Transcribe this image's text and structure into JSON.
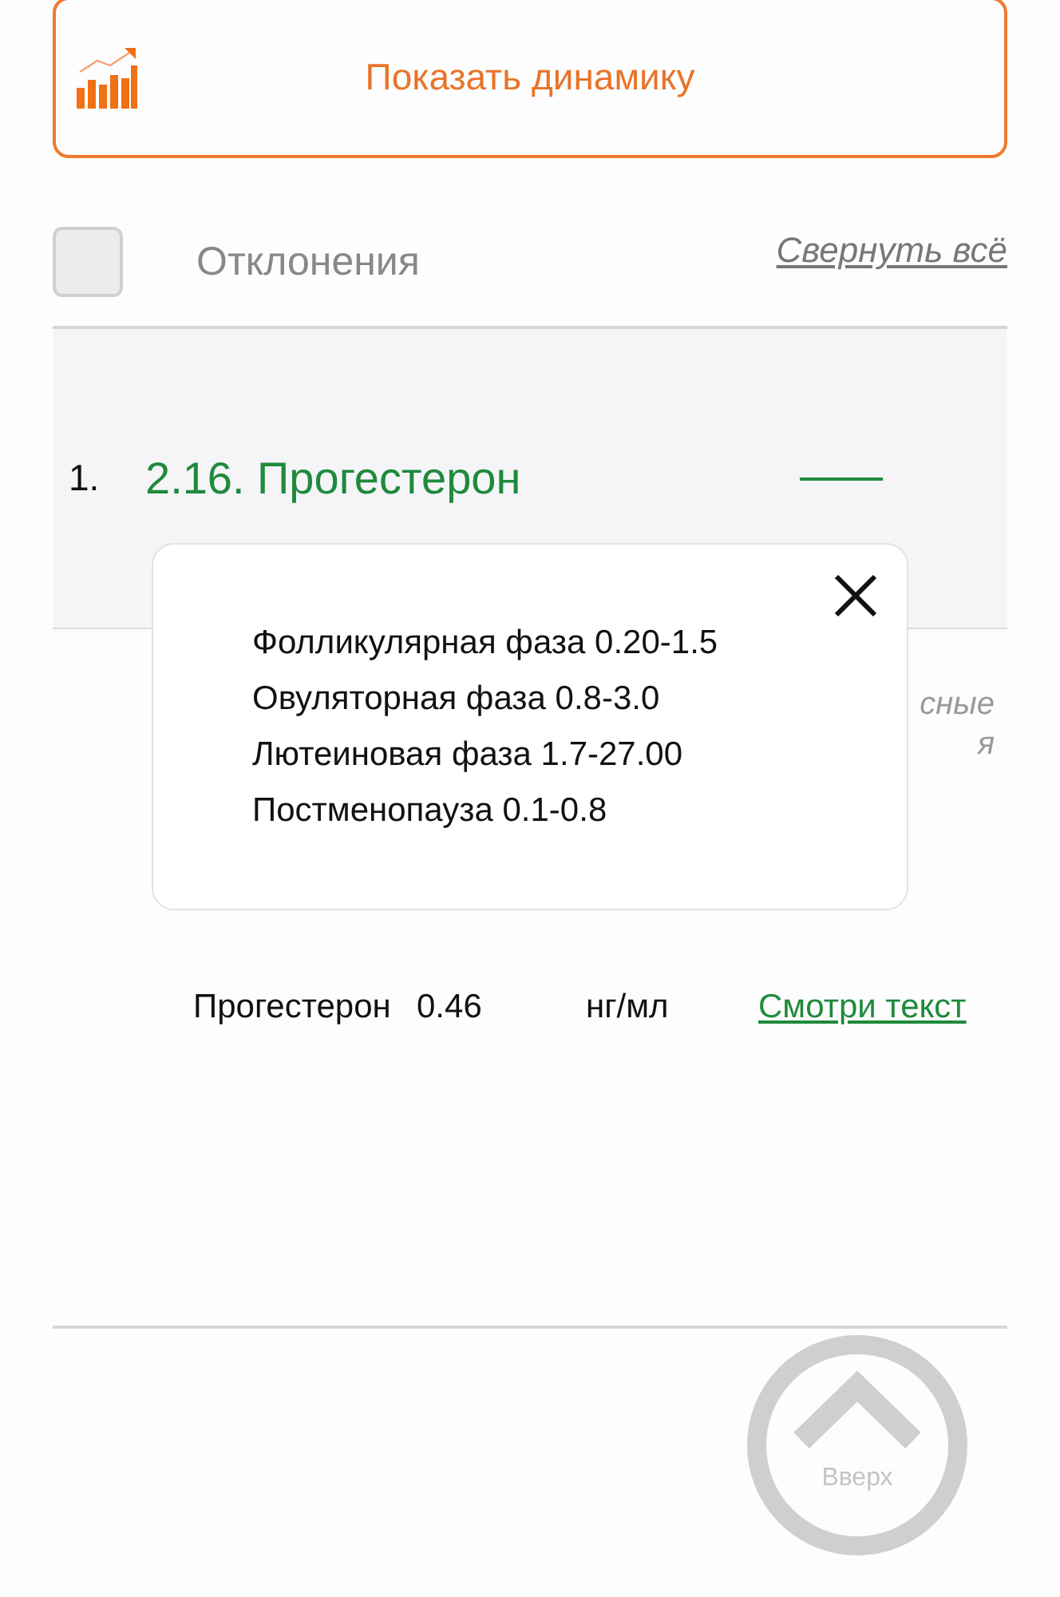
{
  "dynamics_button": {
    "label": "Показать динамику"
  },
  "filter": {
    "checked": false,
    "label": "Отклонения",
    "collapse_link": "Свернуть всё"
  },
  "test": {
    "number": "1.",
    "title": "2.16. Прогестерон",
    "note_lines": [
      "сные",
      "я"
    ],
    "row": {
      "name": "Прогестерон",
      "value": "0.46",
      "unit": "нг/мл",
      "link": "Смотри текст"
    }
  },
  "popup": {
    "lines": [
      "Фолликулярная фаза 0.20-1.5",
      "Овуляторная фаза 0.8-3.0",
      "Лютеиновая фаза 1.7-27.00",
      "Постменопауза 0.1-0.8"
    ]
  },
  "up_button": {
    "label": "Вверх"
  }
}
